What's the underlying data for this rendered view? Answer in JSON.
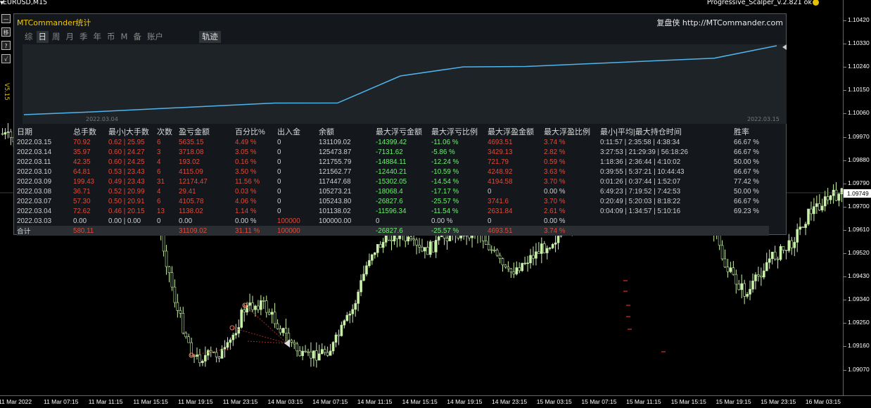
{
  "chart": {
    "symbol": "EURUSD,M15",
    "expert": "Progressive_Scalper_v.2.821 ok",
    "current_price": "1.09749",
    "price_ticks": [
      "1.10420",
      "1.10330",
      "1.10240",
      "1.10150",
      "1.10060",
      "1.09970",
      "1.09880",
      "1.09790",
      "1.09700",
      "1.09610",
      "1.09520",
      "1.09430",
      "1.09340",
      "1.09250",
      "1.09160",
      "1.09070"
    ],
    "time_ticks": [
      "11 Mar 2022",
      "11 Mar 07:15",
      "11 Mar 11:15",
      "11 Mar 15:15",
      "11 Mar 19:15",
      "11 Mar 23:15",
      "14 Mar 03:15",
      "14 Mar 07:15",
      "14 Mar 11:15",
      "14 Mar 15:15",
      "14 Mar 19:15",
      "14 Mar 23:15",
      "15 Mar 03:15",
      "15 Mar 07:15",
      "15 Mar 11:15",
      "15 Mar 15:15",
      "15 Mar 19:15",
      "15 Mar 23:15",
      "16 Mar 03:15"
    ],
    "colors": {
      "candle": "#c8f0a8",
      "background": "#000000"
    }
  },
  "toolbar": {
    "buttons": [
      "—",
      "移",
      "?",
      "√"
    ],
    "version": "V5.15"
  },
  "panel": {
    "title": "MTCommander统计",
    "link": "复盘侠 http://MTCommander.com",
    "tabs": [
      "综",
      "日",
      "周",
      "月",
      "季",
      "年",
      "币",
      "M",
      "备",
      "账户"
    ],
    "active_tab": "日",
    "track_tab": "轨迹",
    "graph": {
      "start_date": "2022.03.04",
      "end_date": "2022.03.15",
      "balance_points": [
        100000.0,
        101138.02,
        105243.8,
        105273.21,
        117447.68,
        121562.77,
        121755.79,
        125473.87,
        131109.02
      ],
      "line_color": "#4fb4ec"
    },
    "table": {
      "headers": [
        "日期",
        "总手数",
        "最小|大手数",
        "次数",
        "盈亏金额",
        "百分比%",
        "出入金",
        "余额",
        "最大浮亏金额",
        "最大浮亏比例",
        "最大浮盈金额",
        "最大浮盈比例",
        "最小|平均|最大持仓时间",
        "胜率"
      ],
      "rows": [
        [
          "2022.03.15",
          "70.92",
          "0.62 | 25.95",
          "6",
          "5635.15",
          "4.49 %",
          "0",
          "131109.02",
          "-14399.42",
          "-11.06 %",
          "4693.51",
          "3.74 %",
          "0:11:57 | 2:35:58 | 4:38:34",
          "66.67 %"
        ],
        [
          "2022.03.14",
          "35.97",
          "0.60 | 24.27",
          "3",
          "3718.08",
          "3.05 %",
          "0",
          "125473.87",
          "-7131.62",
          "-5.86 %",
          "3429.13",
          "2.82 %",
          "3:27:53 | 21:29:39 | 56:18:26",
          "66.67 %"
        ],
        [
          "2022.03.11",
          "42.35",
          "0.60 | 24.25",
          "4",
          "193.02",
          "0.16 %",
          "0",
          "121755.79",
          "-14884.11",
          "-12.24 %",
          "721.79",
          "0.59 %",
          "1:18:36 | 2:36:44 | 4:10:02",
          "50.00 %"
        ],
        [
          "2022.03.10",
          "64.81",
          "0.53 | 23.43",
          "6",
          "4115.09",
          "3.50 %",
          "0",
          "121562.77",
          "-12440.21",
          "-10.59 %",
          "4248.92",
          "3.63 %",
          "0:39:55 | 5:37:21 | 10:44:43",
          "66.67 %"
        ],
        [
          "2022.03.09",
          "199.43",
          "0.49 | 23.43",
          "31",
          "12174.47",
          "11.56 %",
          "0",
          "117447.68",
          "-15302.05",
          "-14.54 %",
          "4194.58",
          "3.70 %",
          "0:01:26 | 0:37:44 | 1:52:07",
          "77.42 %"
        ],
        [
          "2022.03.08",
          "36.71",
          "0.52 | 20.99",
          "4",
          "29.41",
          "0.03 %",
          "0",
          "105273.21",
          "-18068.4",
          "-17.17 %",
          "0",
          "0.00 %",
          "6:49:23 | 7:19:52 | 7:42:53",
          "50.00 %"
        ],
        [
          "2022.03.07",
          "57.30",
          "0.50 | 20.91",
          "6",
          "4105.78",
          "4.06 %",
          "0",
          "105243.80",
          "-26827.6",
          "-25.57 %",
          "3741.6",
          "3.70 %",
          "0:20:49 | 5:20:03 | 8:18:22",
          "66.67 %"
        ],
        [
          "2022.03.04",
          "72.62",
          "0.46 | 20.15",
          "13",
          "1138.02",
          "1.14 %",
          "0",
          "101138.02",
          "-11596.34",
          "-11.54 %",
          "2631.84",
          "2.61 %",
          "0:04:09 | 1:34:57 | 5:10:16",
          "69.23 %"
        ],
        [
          "2022.03.03",
          "0.00",
          "0.00 | 0.00",
          "0",
          "0.00",
          "0.00 %",
          "100000",
          "100000.00",
          "0",
          "0.00 %",
          "0",
          "0.00 %",
          "",
          ""
        ]
      ],
      "total": [
        "合计",
        "580.11",
        "",
        "",
        "31109.02",
        "31.11 %",
        "100000",
        "",
        "-26827.6",
        "-25.57 %",
        "4693.51",
        "3.74 %",
        "",
        ""
      ]
    }
  }
}
